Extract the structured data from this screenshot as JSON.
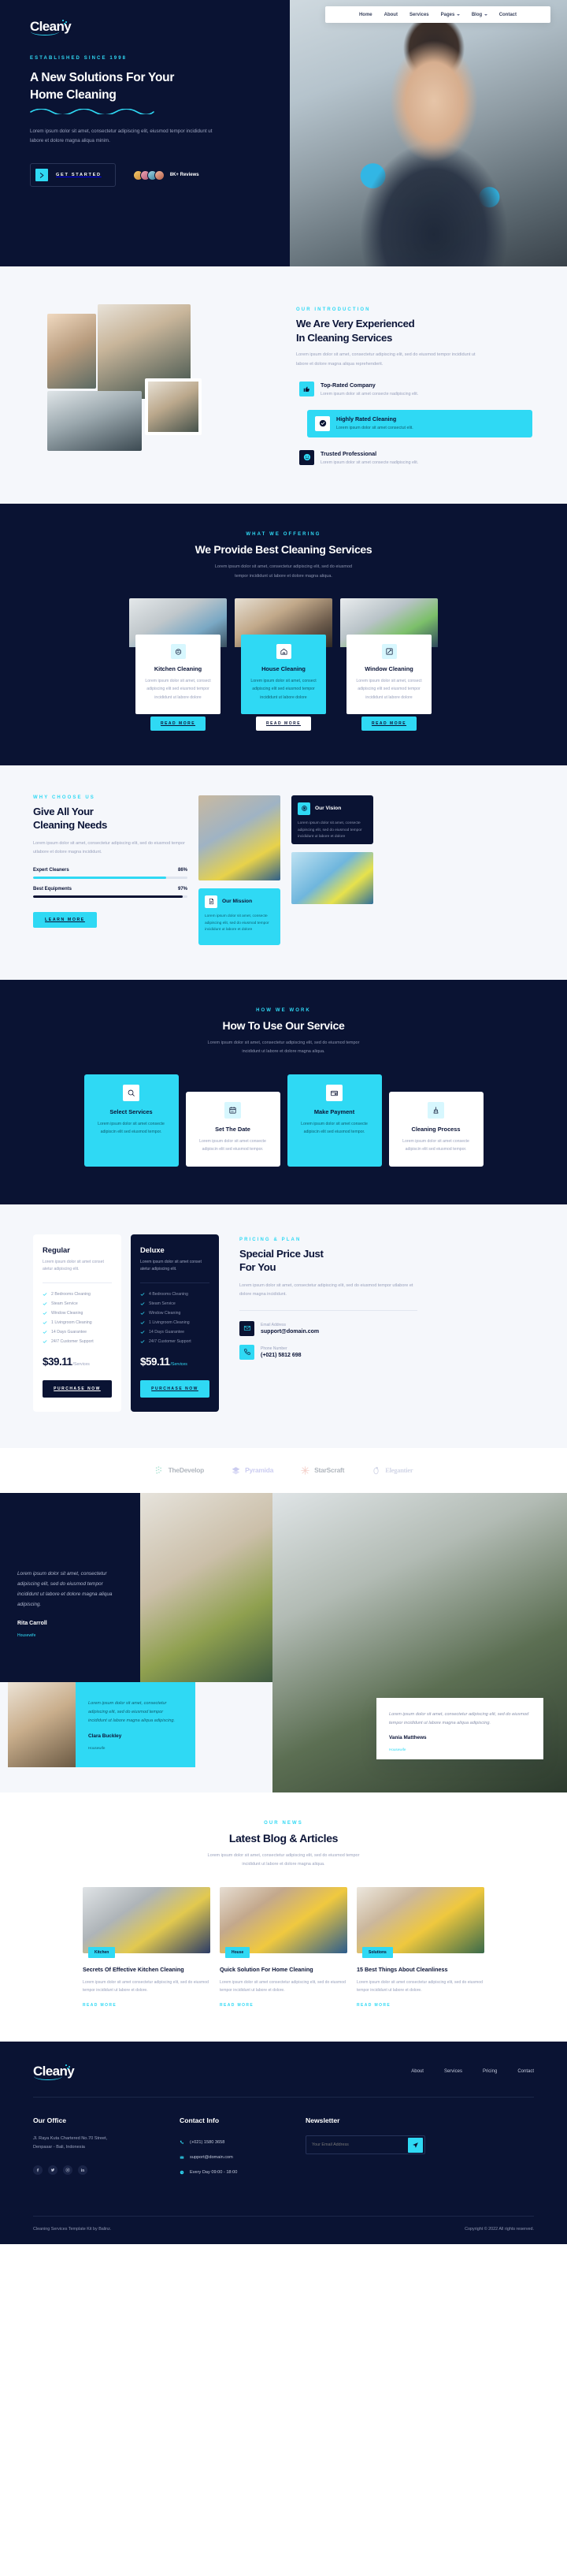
{
  "brand": {
    "name": "Cleany"
  },
  "nav": {
    "items": [
      {
        "label": "Home",
        "dropdown": false
      },
      {
        "label": "About",
        "dropdown": false
      },
      {
        "label": "Services",
        "dropdown": false
      },
      {
        "label": "Pages",
        "dropdown": true
      },
      {
        "label": "Blog",
        "dropdown": true
      },
      {
        "label": "Contact",
        "dropdown": false
      }
    ]
  },
  "hero": {
    "eyebrow": "ESTABLISHED SINCE 1998",
    "title_line1": "A New Solutions For Your",
    "title_line2": "Home Cleaning",
    "paragraph": "Lorem ipsum dolor sit amet, consectetur adipiscing elit, eiusmod tempor incididunt ut labore et dolore magna aliqua minim.",
    "cta": "GET STARTED",
    "reviews": "8K+ Reviews"
  },
  "intro": {
    "eyebrow": "OUR INTRODUCTION",
    "title_line1": "We Are Very Experienced",
    "title_line2": "In Cleaning Services",
    "paragraph": "Lorem ipsum dolor sit amet, consectetur adipiscing elit, sed do eiusmod tempor incididunt ut labore et dolore magna aliqua reprehenderit.",
    "features": [
      {
        "title": "Top-Rated Company",
        "desc": "Lorem ipsum dolor sit amet consecte nadipiscing elit.",
        "icon": "thumbs-up-icon"
      },
      {
        "title": "Highly Rated Cleaning",
        "desc": "Lorem ipsum dolor sit amet consectut elit.",
        "icon": "check-circle-icon"
      },
      {
        "title": "Trusted Professional",
        "desc": "Lorem ipsum dolor sit amet consecte nadipiscing elit.",
        "icon": "smile-icon"
      }
    ]
  },
  "services": {
    "eyebrow": "WHAT WE OFFERING",
    "title": "We Provide Best Cleaning Services",
    "sub_line1": "Lorem ipsum dolor sit amet, consectetur adipiscing elit, sed do eiusmod",
    "sub_line2": "tempor incididunt ut labore et dolore magna aliqua.",
    "cards": [
      {
        "title": "Kitchen Cleaning",
        "desc": "Lorem ipsum dolor sit amet, consect adipiscing elit sed eiusmod tempor incididunt ut labore dolore",
        "button": "READ MORE",
        "icon": "spray-icon"
      },
      {
        "title": "House Cleaning",
        "desc": "Lorem ipsum dolor sit amet, consect adipiscing elit sed eiusmod tempor incididunt ut labore dolore",
        "button": "READ MORE",
        "icon": "house-icon"
      },
      {
        "title": "Window Cleaning",
        "desc": "Lorem ipsum dolor sit amet, consect adipiscing elit sed eiusmod tempor incididunt ut labore dolore",
        "button": "READ MORE",
        "icon": "squeegee-icon"
      }
    ]
  },
  "why": {
    "eyebrow": "WHY CHOOSE US",
    "title_line1": "Give All Your",
    "title_line2": "Cleaning Needs",
    "paragraph": "Lorem ipsum dolor sit amet, consectetur adipiscing elit, sed do eiusmod tempor utlabore et dolore magna incididunt.",
    "bars": [
      {
        "label": "Expert Cleaners",
        "value": "86%",
        "pct": 86
      },
      {
        "label": "Best Equipments",
        "value": "97%",
        "pct": 97
      }
    ],
    "button": "LEARN MORE",
    "vision": {
      "title": "Our Vision",
      "desc": "Lorem ipsum dolor sit amet, consecte adipiscing elit, sed do eiusmod tempor incididunt ut labore et dolore",
      "icon": "target-icon"
    },
    "mission": {
      "title": "Our Mission",
      "desc": "Lorem ipsum dolor sit amet, consecte adipiscing elit, sed do eiusmod tempor incididunt ut labore et dolore",
      "icon": "document-icon"
    }
  },
  "how": {
    "eyebrow": "HOW WE WORK",
    "title": "How To Use Our Service",
    "sub_line1": "Lorem ipsum dolor sit amet, consectetur adipiscing elit, sed do eiusmod tempor",
    "sub_line2": "incididunt ut labore et dolore magna aliqua.",
    "steps": [
      {
        "title": "Select Services",
        "desc": "Lorem ipsum dolor sit amet consecte adipiscin elit sed eiusmod tempor.",
        "icon": "search-icon",
        "active": true
      },
      {
        "title": "Set The Date",
        "desc": "Lorem ipsum dolor sit amet consecte adipiscin elit sed eiusmod tempor.",
        "icon": "calendar-icon",
        "active": false
      },
      {
        "title": "Make Payment",
        "desc": "Lorem ipsum dolor sit amet consecte adipiscin elit sed eiusmod tempor.",
        "icon": "credit-card-icon",
        "active": true
      },
      {
        "title": "Cleaning Process",
        "desc": "Lorem ipsum dolor sit amet consecte adipiscin elit sed eiusmod tempor.",
        "icon": "vacuum-icon",
        "active": false
      }
    ]
  },
  "pricing": {
    "eyebrow": "PRICING & PLAN",
    "title_line1": "Special Price Just",
    "title_line2": "For You",
    "paragraph": "Lorem ipsum dolor sit amet, consectetur adipiscing elit, sed do eiusmod tempor utlabore et dolore magna incididunt.",
    "email_label": "Email Address",
    "email_value": "support@domain.com",
    "phone_label": "Phone Number",
    "phone_value": "(+021) 5812 698",
    "plans": [
      {
        "name": "Regular",
        "desc": "Lorem ipsum dolor sit amet conset atetur adipiscing elit.",
        "features": [
          "2 Bedrooms Cleaning",
          "Steam Service",
          "Window Cleaning",
          "1 Livingroom Cleaning",
          "14 Days Guarantee",
          "24/7 Customer Support"
        ],
        "price": "$39.11",
        "unit": "/Services",
        "button": "PURCHASE NOW"
      },
      {
        "name": "Deluxe",
        "desc": "Lorem ipsum dolor sit amet conset atetur adipiscing elit.",
        "features": [
          "4 Bedrooms Cleaning",
          "Steam Service",
          "Window Cleaning",
          "1 Livingroom Cleaning",
          "14 Days Guarantee",
          "24/7 Customer Support"
        ],
        "price": "$59.11",
        "unit": "/Services",
        "button": "PURCHASE NOW"
      }
    ]
  },
  "brands": [
    {
      "name": "TheDevelop",
      "icon": "dots-grid-icon",
      "color": "#4fc3a1"
    },
    {
      "name": "Pyramida",
      "icon": "layers-icon",
      "color": "#8d8fe0"
    },
    {
      "name": "StarScraft",
      "icon": "starburst-icon",
      "color": "#e89a8c"
    },
    {
      "name": "Elegantier",
      "icon": "ring-icon",
      "color": "#9aa3c9"
    }
  ],
  "testimonials": [
    {
      "quote": "Lorem ipsum dolor sit amet, consectetur adipiscing elit, sed do eiusmod tempor incididunt ut labore et dolore magna aliqua adipiscing.",
      "name": "Rita Carroll",
      "role": "Housewife"
    },
    {
      "quote": "Lorem ipsum dolor sit amet, consectetur adipiscing elit, sed do eiusmod tempor incididunt ut labore magna aliqua adipiscing.",
      "name": "Clara Buckley",
      "role": "Housewife"
    },
    {
      "quote": "Lorem ipsum dolor sit amet, consectetur adipiscing elit, sed do eiusmod tempor incididunt ut labore magna aliqua adipiscing.",
      "name": "Vania Matthews",
      "role": "Housewife"
    }
  ],
  "blog": {
    "eyebrow": "OUR NEWS",
    "title": "Latest Blog & Articles",
    "sub_line1": "Lorem ipsum dolor sit amet, consectetur adipiscing elit, sed do eiusmod tempor",
    "sub_line2": "incididunt ut labore et dolore magna aliqua.",
    "posts": [
      {
        "tag": "Kitchen",
        "title": "Secrets Of Effective Kitchen Cleaning",
        "desc": "Lorem ipsum dolor sit amet consectetur adipiscing elit, sed do eiusmod tempor incididunt ut labore et dolore.",
        "link": "READ MORE"
      },
      {
        "tag": "House",
        "title": "Quick Solution For Home Cleaning",
        "desc": "Lorem ipsum dolor sit amet consectetur adipiscing elit, sed do eiusmod tempor incididunt ut labore et dolore.",
        "link": "READ MORE"
      },
      {
        "tag": "Solutions",
        "title": "15 Best Things About Cleanliness",
        "desc": "Lorem ipsum dolor sit amet consectetur adipiscing elit, sed do eiusmod tempor incididunt ut labore et dolore.",
        "link": "READ MORE"
      }
    ]
  },
  "footer": {
    "nav": [
      "About",
      "Services",
      "Pricing",
      "Contact"
    ],
    "office": {
      "heading": "Our Office",
      "address_line1": "Jl. Raya Kuta Chartered No.70 Street,",
      "address_line2": "Denpasar - Bali, Indonesia",
      "socials": [
        "facebook-icon",
        "twitter-icon",
        "instagram-icon",
        "linkedin-icon"
      ]
    },
    "contact": {
      "heading": "Contact Info",
      "items": [
        {
          "icon": "phone-icon",
          "text": "(+021) 1580 3658"
        },
        {
          "icon": "mail-icon",
          "text": "support@domain.com"
        },
        {
          "icon": "clock-icon",
          "text": "Every Day 09:00 - 18:00"
        }
      ]
    },
    "newsletter": {
      "heading": "Newsletter",
      "placeholder": "Your Email Address",
      "button": "send-icon"
    },
    "credit": "Cleaning Services Template Kit by Balinz.",
    "copyright": "Copyright © 2022 All rights reserved."
  }
}
